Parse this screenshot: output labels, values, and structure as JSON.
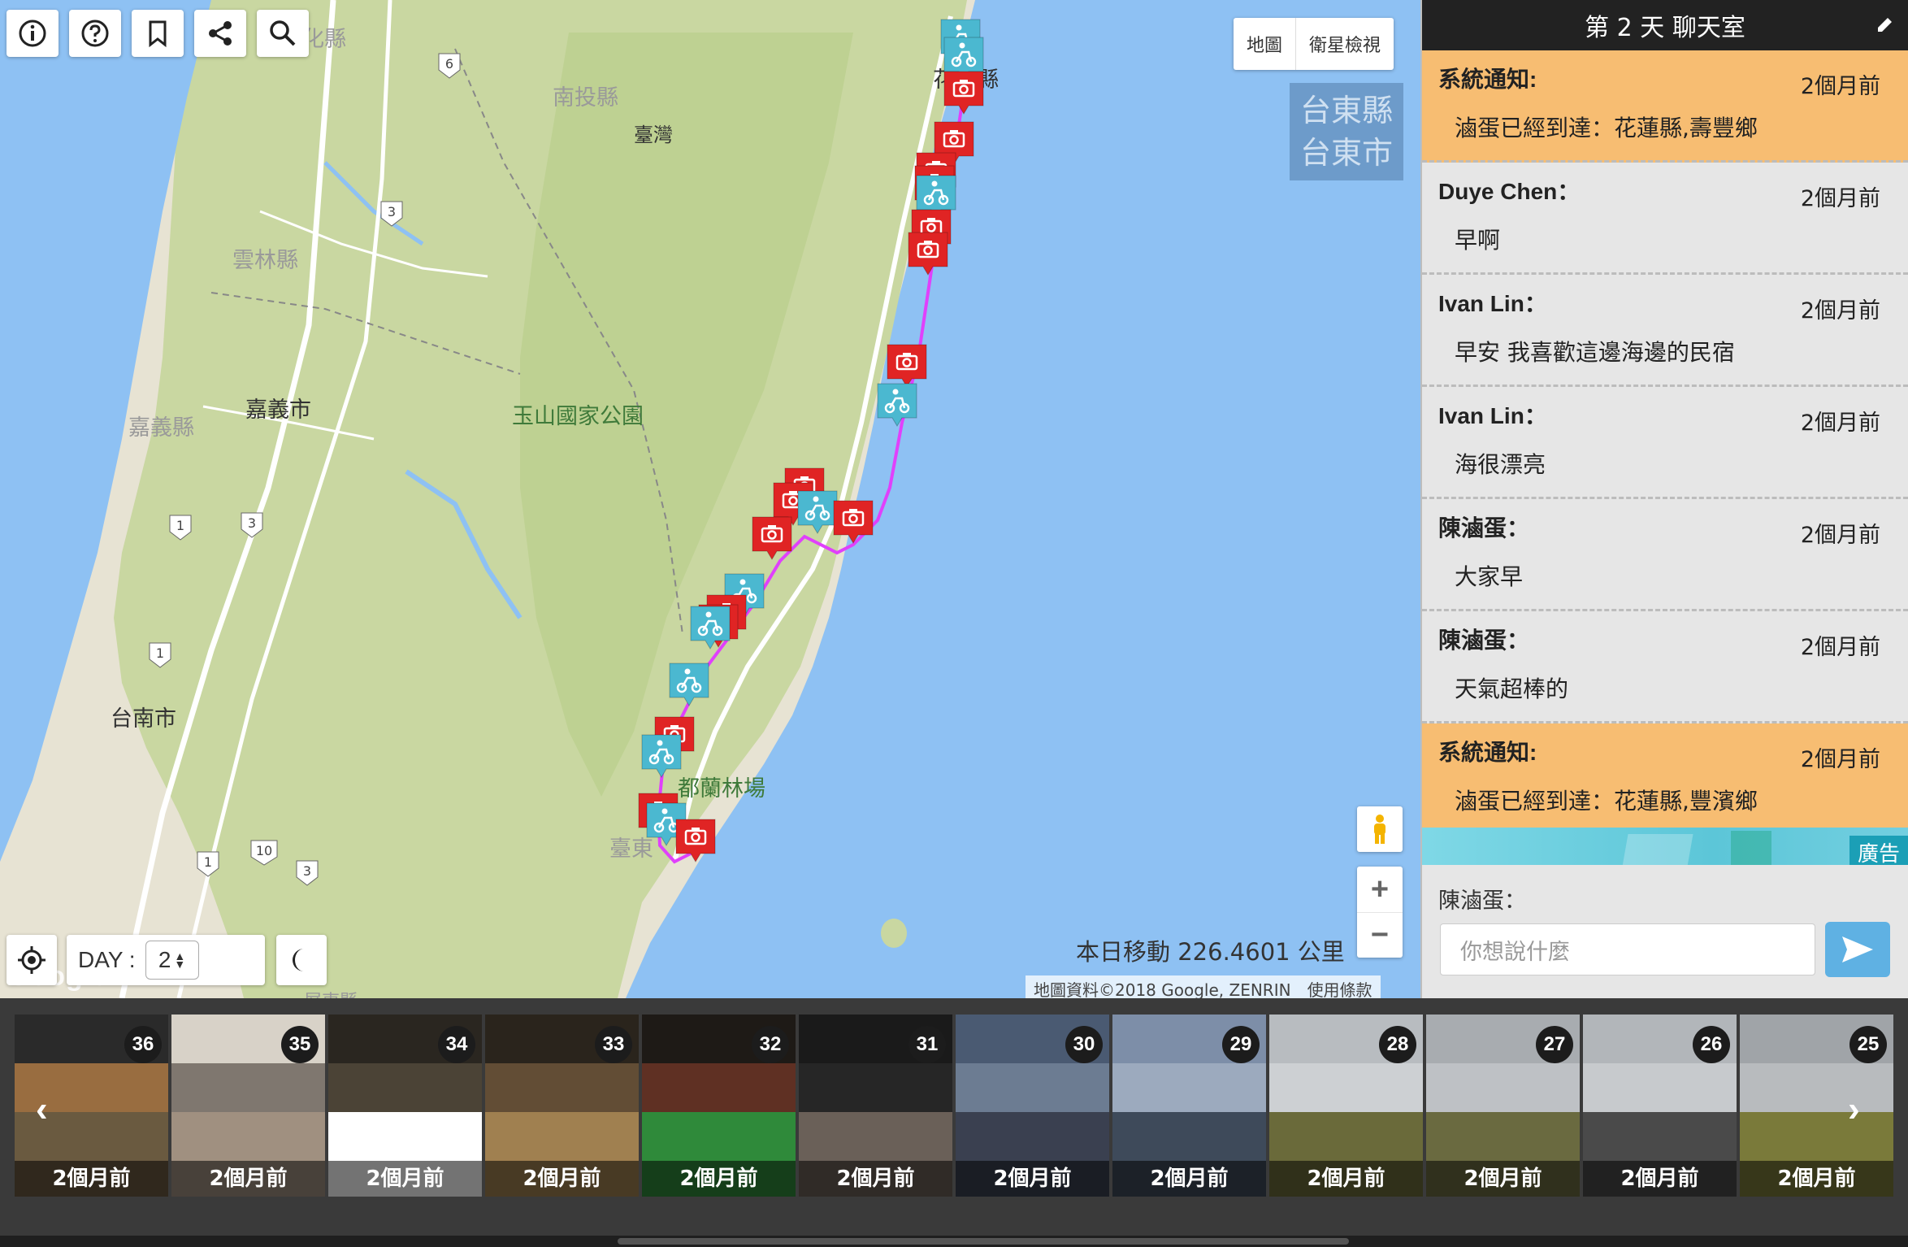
{
  "toolbar": {
    "icons": [
      "info-icon",
      "help-icon",
      "bookmark-icon",
      "share-icon",
      "search-icon"
    ]
  },
  "map": {
    "type_buttons": [
      "地圖",
      "衛星檢視"
    ],
    "region_label": [
      "台東縣",
      "台東市"
    ],
    "labels": {
      "hualien_county": "花蓮縣",
      "hualien_top": "化縣",
      "nantou": "南投縣",
      "taiwan": "臺灣",
      "yunlin": "雲林縣",
      "chiayi_city": "嘉義市",
      "chiayi_county": "嘉義縣",
      "yushan": "玉山國家公園",
      "tainan": "台南市",
      "dulan": "都蘭林場",
      "taitung_small": "臺東",
      "pingtung": "屏東縣"
    },
    "road_numbers": [
      "6",
      "3",
      "1",
      "3",
      "1",
      "1",
      "10",
      "3"
    ],
    "distance": "本日移動 226.4601 公里",
    "attribution": "地圖資料©2018 Google, ZENRIN",
    "terms": "使用條款",
    "google_logo": "Google",
    "zoom_in": "+",
    "zoom_out": "−",
    "day_label": "DAY :",
    "day_value": "2",
    "route_color": "#e040fb",
    "camera_marker_color": "#e02424",
    "scooter_marker_color": "#4bb8d0"
  },
  "chat": {
    "title": "第 2 天 聊天室",
    "messages": [
      {
        "sender": "系統通知:",
        "time": "2個月前",
        "text": "滷蛋已經到達：花蓮縣,壽豐鄉",
        "system": true
      },
      {
        "sender": "Duye Chen：",
        "time": "2個月前",
        "text": "早啊",
        "system": false
      },
      {
        "sender": "Ivan Lin：",
        "time": "2個月前",
        "text": "早安 我喜歡這邊海邊的民宿",
        "system": false
      },
      {
        "sender": "Ivan Lin：",
        "time": "2個月前",
        "text": "海很漂亮",
        "system": false
      },
      {
        "sender": "陳滷蛋：",
        "time": "2個月前",
        "text": "大家早",
        "system": false
      },
      {
        "sender": "陳滷蛋：",
        "time": "2個月前",
        "text": "天氣超棒的",
        "system": false
      },
      {
        "sender": "系統通知:",
        "time": "2個月前",
        "text": "滷蛋已經到達：花蓮縣,豐濱鄉",
        "system": true
      }
    ],
    "ad_label": "廣告",
    "composer_user": "陳滷蛋：",
    "input_placeholder": "你想說什麼"
  },
  "photos": [
    {
      "num": "36",
      "ago": "2個月前"
    },
    {
      "num": "35",
      "ago": "2個月前"
    },
    {
      "num": "34",
      "ago": "2個月前"
    },
    {
      "num": "33",
      "ago": "2個月前"
    },
    {
      "num": "32",
      "ago": "2個月前"
    },
    {
      "num": "31",
      "ago": "2個月前"
    },
    {
      "num": "30",
      "ago": "2個月前"
    },
    {
      "num": "29",
      "ago": "2個月前"
    },
    {
      "num": "28",
      "ago": "2個月前"
    },
    {
      "num": "27",
      "ago": "2個月前"
    },
    {
      "num": "26",
      "ago": "2個月前"
    },
    {
      "num": "25",
      "ago": "2個月前"
    }
  ]
}
